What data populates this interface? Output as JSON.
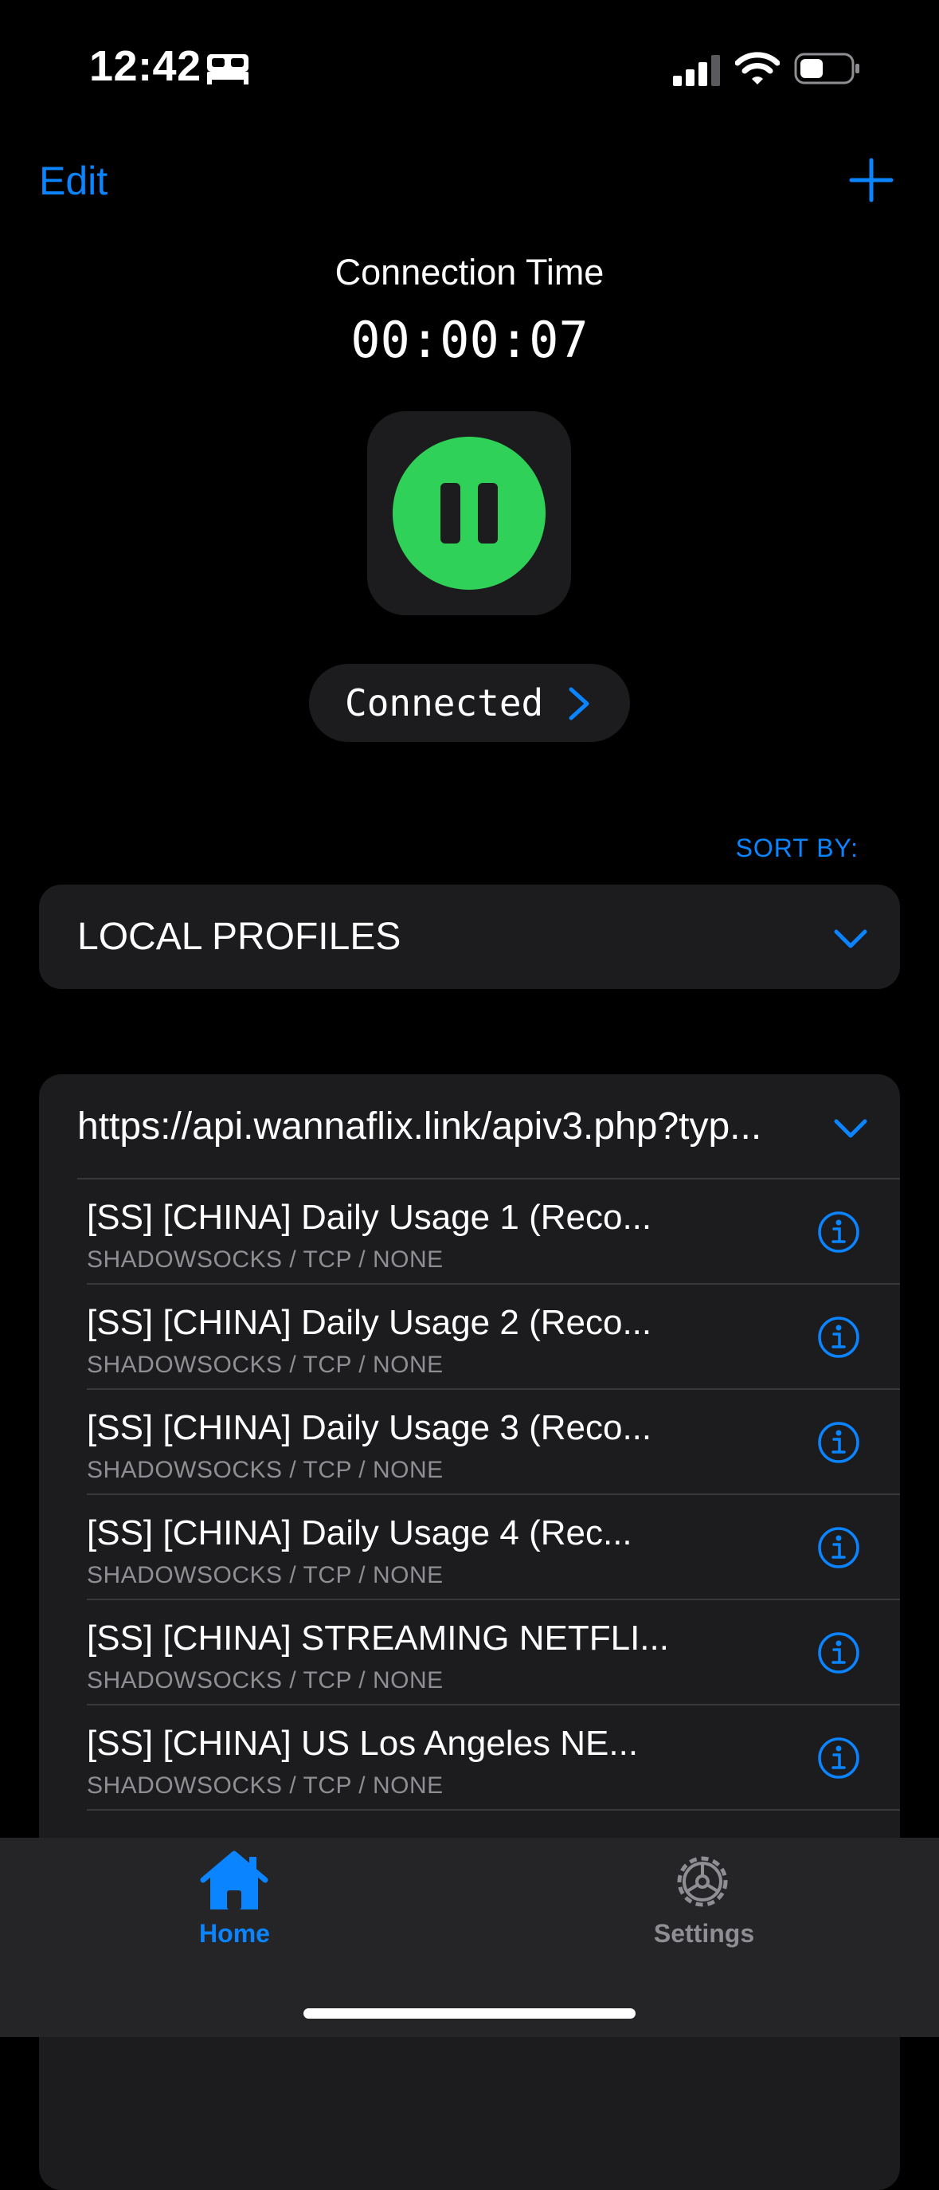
{
  "status_bar": {
    "time": "12:42"
  },
  "nav": {
    "edit_label": "Edit"
  },
  "connection": {
    "title": "Connection Time",
    "timer": "00:00:07",
    "status": "Connected",
    "toggle_color": "#30d158"
  },
  "sort": {
    "label": "SORT BY:"
  },
  "local_profiles": {
    "label": "LOCAL PROFILES"
  },
  "subscription": {
    "url": "https://api.wannaflix.link/apiv3.php?typ...",
    "servers": [
      {
        "name": "[SS] [CHINA] Daily Usage 1 (Reco...",
        "subtitle": "SHADOWSOCKS / TCP / NONE"
      },
      {
        "name": "[SS] [CHINA] Daily Usage 2 (Reco...",
        "subtitle": "SHADOWSOCKS / TCP / NONE"
      },
      {
        "name": "[SS] [CHINA] Daily Usage 3 (Reco...",
        "subtitle": "SHADOWSOCKS / TCP / NONE"
      },
      {
        "name": "[SS] [CHINA] Daily Usage 4 (Rec...",
        "subtitle": "SHADOWSOCKS / TCP / NONE"
      },
      {
        "name": "[SS] [CHINA] STREAMING NETFLI...",
        "subtitle": "SHADOWSOCKS / TCP / NONE"
      },
      {
        "name": "[SS] [CHINA] US Los Angeles NE...",
        "subtitle": "SHADOWSOCKS / TCP / NONE"
      }
    ]
  },
  "tabs": [
    {
      "label": "Home",
      "icon": "house-icon",
      "selected": true
    },
    {
      "label": "Settings",
      "icon": "gear-icon",
      "selected": false
    }
  ],
  "colors": {
    "accent": "#0a84ff",
    "background": "#000000",
    "card": "#1c1c1e",
    "connected": "#30d158"
  }
}
